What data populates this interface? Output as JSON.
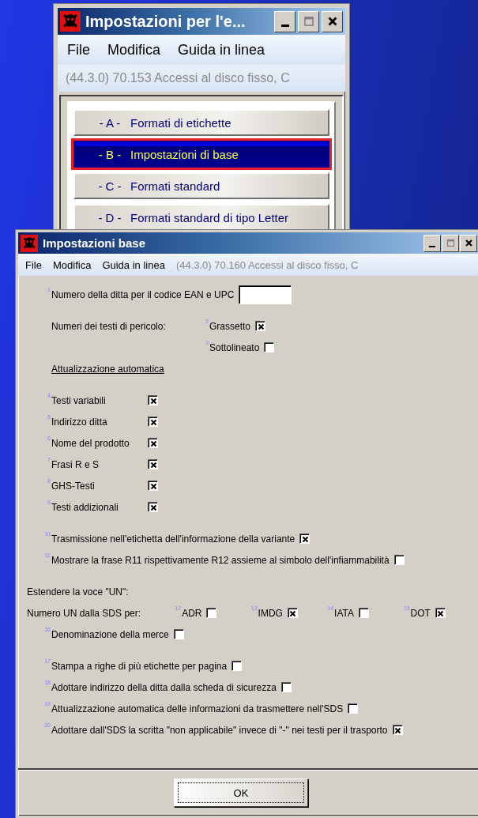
{
  "main_window": {
    "title": "Impostazioni per l'e...",
    "menu": [
      "File",
      "Modifica",
      "Guida in linea"
    ],
    "status": "(44.3.0) 70.153 Accessi al disco fisso, C",
    "sections": [
      {
        "code": "- A -",
        "label": "Formati di etichette",
        "selected": false
      },
      {
        "code": "- B -",
        "label": "Impostazioni di base",
        "selected": true
      },
      {
        "code": "- C -",
        "label": "Formati standard",
        "selected": false
      },
      {
        "code": "- D -",
        "label": "Formati standard di tipo Letter",
        "selected": false
      }
    ]
  },
  "dialog": {
    "title": "Impostazioni base",
    "menu": [
      "File",
      "Modifica",
      "Guida in linea"
    ],
    "status": "(44.3.0) 70.160 Accessi al disco fisso, C",
    "ean": {
      "number": "1",
      "label": "Numero della ditta per il codice EAN e UPC"
    },
    "hazard": {
      "label": "Numeri dei testi di pericolo:",
      "options": [
        {
          "number": "2",
          "label": "Grassetto",
          "checked": true
        },
        {
          "number": "3",
          "label": "Sottolineato",
          "checked": false
        }
      ]
    },
    "auto_update": {
      "heading": "Attualizzazione automatica",
      "items": [
        {
          "number": "4",
          "label": "Testi variabili",
          "checked": true
        },
        {
          "number": "5",
          "label": "Indirizzo ditta",
          "checked": true
        },
        {
          "number": "6",
          "label": "Nome del prodotto",
          "checked": true
        },
        {
          "number": "7",
          "label": "Frasi R e S",
          "checked": true
        },
        {
          "number": "8",
          "label": "GHS-Testi",
          "checked": true
        },
        {
          "number": "9",
          "label": "Testi addizionali",
          "checked": true
        }
      ]
    },
    "options_a": [
      {
        "number": "10",
        "label": "Trasmissione nell'etichetta dell'informazione della variante",
        "checked": true
      },
      {
        "number": "11",
        "label": "Mostrare la frase R11 rispettivamente R12 assieme al simbolo dell'infiammabilità",
        "checked": false
      }
    ],
    "un": {
      "heading": "Estendere la voce \"UN\":",
      "label": "Numero UN dalla SDS per:",
      "options": [
        {
          "number": "12",
          "label": "ADR",
          "checked": false
        },
        {
          "number": "13",
          "label": "IMDG",
          "checked": true
        },
        {
          "number": "14",
          "label": "IATA",
          "checked": false
        },
        {
          "number": "15",
          "label": "DOT",
          "checked": true
        }
      ],
      "goods_name": {
        "number": "16",
        "label": "Denominazione della merce",
        "checked": false
      }
    },
    "options_b": [
      {
        "number": "17",
        "label": "Stampa a righe di più etichette per pagina",
        "checked": false
      },
      {
        "number": "18",
        "label": "Adottare indirizzo della ditta dalla scheda di sicurezza",
        "checked": false
      },
      {
        "number": "19",
        "label": "Attualizzazione automatica delle informazioni da trasmettere nell'SDS",
        "checked": false
      },
      {
        "number": "20",
        "label": "Adottare dall'SDS la scritta \"non applicabile\" invece di \"-\" nei testi per il trasporto",
        "checked": true
      }
    ],
    "ok_button": "OK"
  }
}
